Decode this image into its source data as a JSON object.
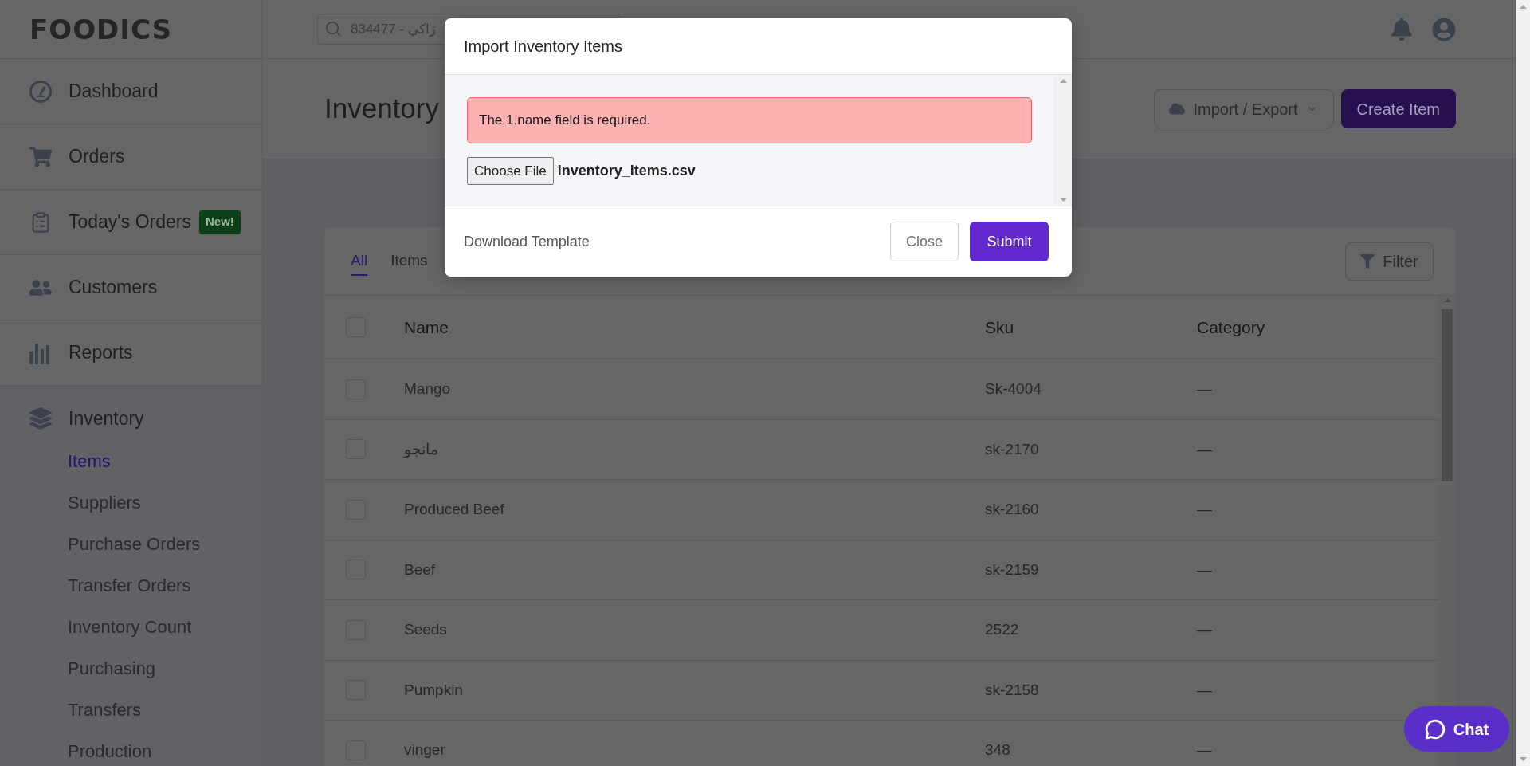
{
  "sidebar": {
    "logo": "FOODICS",
    "nav": [
      {
        "label": "Dashboard",
        "expanded": false
      },
      {
        "label": "Orders",
        "expanded": false
      },
      {
        "label": "Today's Orders",
        "badge": "New!",
        "expanded": false
      },
      {
        "label": "Customers",
        "expanded": false
      },
      {
        "label": "Reports",
        "expanded": false
      },
      {
        "label": "Inventory",
        "expanded": true,
        "children": [
          {
            "label": "Items",
            "selected": true
          },
          {
            "label": "Suppliers",
            "selected": false
          },
          {
            "label": "Purchase Orders",
            "selected": false
          },
          {
            "label": "Transfer Orders",
            "selected": false
          },
          {
            "label": "Inventory Count",
            "selected": false
          },
          {
            "label": "Purchasing",
            "selected": false
          },
          {
            "label": "Transfers",
            "selected": false
          },
          {
            "label": "Production",
            "selected": false
          }
        ]
      }
    ]
  },
  "topbar": {
    "search": {
      "placeholder": "834477 - زاكي"
    }
  },
  "page": {
    "title": "Inventory",
    "buttons": [
      {
        "label": "Import / Export",
        "kind": "dropdown"
      },
      {
        "label": "Create Item",
        "kind": "primary"
      }
    ]
  },
  "table": {
    "tabs": [
      {
        "label": "All",
        "selected": true
      },
      {
        "label": "Items",
        "selected": false
      }
    ],
    "filter": "Filter",
    "select_all_checked": false,
    "columns": [
      "Name",
      "Sku",
      "Category"
    ],
    "rows": [
      {
        "name": "Mango",
        "sku": "Sk-4004",
        "category": "—",
        "checked": false
      },
      {
        "name": "مانجو",
        "sku": "sk-2170",
        "category": "—",
        "checked": false
      },
      {
        "name": "Produced Beef",
        "sku": "sk-2160",
        "category": "—",
        "checked": false
      },
      {
        "name": "Beef",
        "sku": "sk-2159",
        "category": "—",
        "checked": false
      },
      {
        "name": "Seeds",
        "sku": "2522",
        "category": "—",
        "checked": false
      },
      {
        "name": "Pumpkin",
        "sku": "sk-2158",
        "category": "—",
        "checked": false
      },
      {
        "name": "vinger",
        "sku": "348",
        "category": "—",
        "checked": false
      }
    ]
  },
  "modal": {
    "title": "Import Inventory Items",
    "error": "The 1.name field is required.",
    "file_button": "Choose File",
    "file_name": "inventory_items.csv",
    "template_link": "Download Template",
    "buttons": [
      {
        "label": "Close",
        "kind": "secondary"
      },
      {
        "label": "Submit",
        "kind": "primary"
      }
    ]
  },
  "chat": {
    "label": "Chat"
  }
}
